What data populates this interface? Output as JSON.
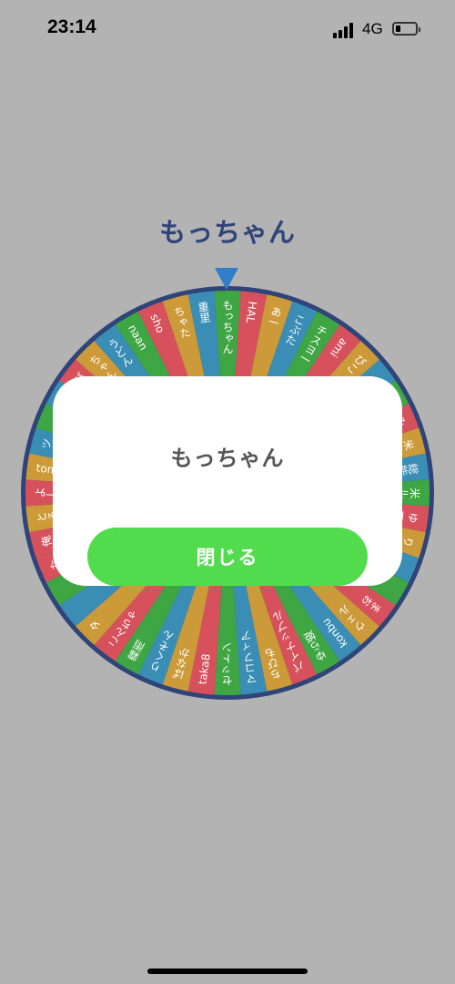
{
  "status_bar": {
    "time": "23:14",
    "network": "4G",
    "battery_level": 0.25
  },
  "result": {
    "title": "もっちゃん"
  },
  "wheel": {
    "colors": {
      "red": "#d6515c",
      "yellow": "#cc9a38",
      "blue": "#3a8db5",
      "green": "#3ea643",
      "rim": "#2f4478"
    },
    "segments": [
      {
        "label": "もっちゃん",
        "color": "green"
      },
      {
        "label": "HAL",
        "color": "red"
      },
      {
        "label": "あ一",
        "color": "yellow"
      },
      {
        "label": "こぶた",
        "color": "blue"
      },
      {
        "label": "チスヨ一",
        "color": "green"
      },
      {
        "label": "ami",
        "color": "red"
      },
      {
        "label": "ぴこ",
        "color": "yellow"
      },
      {
        "label": "",
        "color": "blue"
      },
      {
        "label": "",
        "color": "green"
      },
      {
        "label": "みみ",
        "color": "red"
      },
      {
        "label": "米",
        "color": "yellow"
      },
      {
        "label": "総能",
        "color": "blue"
      },
      {
        "label": "米ル",
        "color": "green"
      },
      {
        "label": "ゆ一",
        "color": "red"
      },
      {
        "label": "りり",
        "color": "yellow"
      },
      {
        "label": "",
        "color": "blue"
      },
      {
        "label": "",
        "color": "green"
      },
      {
        "label": "まお",
        "color": "red"
      },
      {
        "label": "ウェル",
        "color": "yellow"
      },
      {
        "label": "konbu",
        "color": "blue"
      },
      {
        "label": "ゆら姫",
        "color": "green"
      },
      {
        "label": "パイナップル",
        "color": "red"
      },
      {
        "label": "ちびも",
        "color": "yellow"
      },
      {
        "label": "マコフィア",
        "color": "blue"
      },
      {
        "label": "セットン",
        "color": "green"
      },
      {
        "label": "taka8",
        "color": "red"
      },
      {
        "label": "ぱなか",
        "color": "yellow"
      },
      {
        "label": "りくそん",
        "color": "blue"
      },
      {
        "label": "霧雨",
        "color": "green"
      },
      {
        "label": "こんちゃ",
        "color": "red"
      },
      {
        "label": "タ",
        "color": "yellow"
      },
      {
        "label": "",
        "color": "blue"
      },
      {
        "label": "",
        "color": "green"
      },
      {
        "label": "たま",
        "color": "red"
      },
      {
        "label": "俺タ",
        "color": "red"
      },
      {
        "label": "とる",
        "color": "yellow"
      },
      {
        "label": "よし",
        "color": "red"
      },
      {
        "label": "tom",
        "color": "yellow"
      },
      {
        "label": "ツ",
        "color": "blue"
      },
      {
        "label": "",
        "color": "green"
      },
      {
        "label": "",
        "color": "blue"
      },
      {
        "label": "ぴゃ",
        "color": "red"
      },
      {
        "label": "ちゃん",
        "color": "yellow"
      },
      {
        "label": "うどん",
        "color": "blue"
      },
      {
        "label": "naan",
        "color": "green"
      },
      {
        "label": "sho",
        "color": "red"
      },
      {
        "label": "ちゃた",
        "color": "yellow"
      },
      {
        "label": "重里",
        "color": "blue"
      }
    ]
  },
  "dialog": {
    "message": "もっちゃん",
    "close_label": "閉じる"
  }
}
